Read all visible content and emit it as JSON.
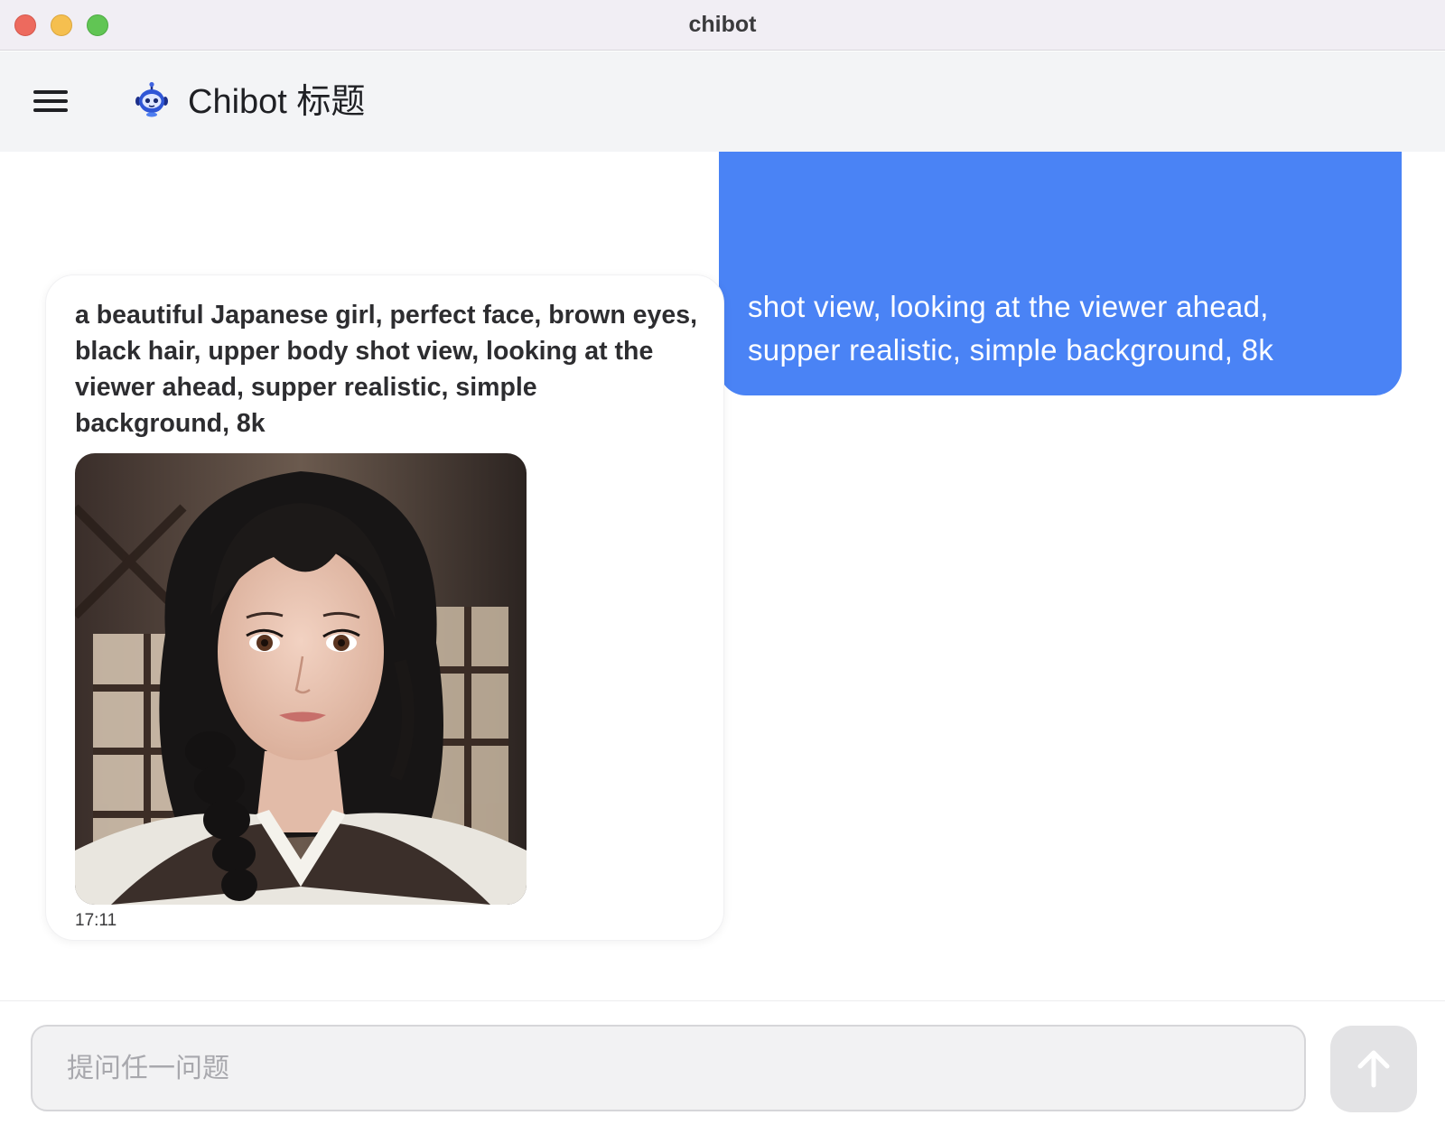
{
  "window": {
    "title": "chibot"
  },
  "header": {
    "app_title": "Chibot 标题",
    "menu_icon": "hamburger-menu-icon",
    "logo_icon": "robot-icon"
  },
  "messages": {
    "user": {
      "text_visible": "shot view, looking at the viewer ahead,\nsupper realistic, simple background, 8k"
    },
    "bot": {
      "text": "a beautiful Japanese girl, perfect face, brown eyes, black hair, upper body shot view, looking at the viewer ahead, supper realistic, simple background, 8k",
      "time": "17:11",
      "image": "generated-portrait-image"
    }
  },
  "composer": {
    "placeholder": "提问任一问题",
    "value": "",
    "send_icon": "arrow-up-icon"
  },
  "colors": {
    "user_bubble": "#4a83f5",
    "header_bg": "#f3f4f6",
    "titlebar_bg": "#f1eef4",
    "send_button_bg": "#e3e3e5"
  }
}
